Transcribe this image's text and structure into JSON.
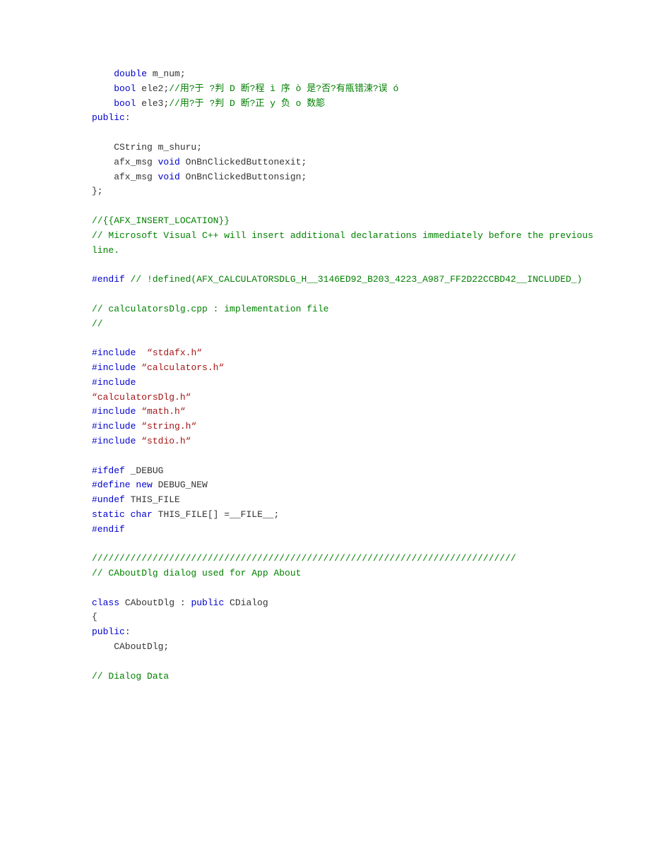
{
  "lines": [
    {
      "segments": [
        {
          "t": "    ",
          "c": ""
        },
        {
          "t": "double",
          "c": "kw"
        },
        {
          "t": " m_num;",
          "c": ""
        }
      ]
    },
    {
      "segments": [
        {
          "t": "    ",
          "c": ""
        },
        {
          "t": "bool",
          "c": "kw"
        },
        {
          "t": " ele2;",
          "c": ""
        },
        {
          "t": "//用?于 ?判 D 断?程 ì 序 ò 是?否?有甁错涑?误 ó",
          "c": "cm"
        }
      ]
    },
    {
      "segments": [
        {
          "t": "    ",
          "c": ""
        },
        {
          "t": "bool",
          "c": "kw"
        },
        {
          "t": " ele3;",
          "c": ""
        },
        {
          "t": "//用?于 ?判 D 断?正 y 负 o 数簓",
          "c": "cm"
        }
      ]
    },
    {
      "segments": [
        {
          "t": "public",
          "c": "kw"
        },
        {
          "t": ":",
          "c": ""
        }
      ]
    },
    {
      "segments": [
        {
          "t": " ",
          "c": ""
        }
      ]
    },
    {
      "segments": [
        {
          "t": "    CString m_shuru;",
          "c": ""
        }
      ]
    },
    {
      "segments": [
        {
          "t": "    afx_msg ",
          "c": ""
        },
        {
          "t": "void",
          "c": "kw"
        },
        {
          "t": " OnBnClickedButtonexit;",
          "c": ""
        }
      ]
    },
    {
      "segments": [
        {
          "t": "    afx_msg ",
          "c": ""
        },
        {
          "t": "void",
          "c": "kw"
        },
        {
          "t": " OnBnClickedButtonsign;",
          "c": ""
        }
      ]
    },
    {
      "segments": [
        {
          "t": "};",
          "c": ""
        }
      ]
    },
    {
      "segments": [
        {
          "t": " ",
          "c": ""
        }
      ]
    },
    {
      "segments": [
        {
          "t": "//{{AFX_INSERT_LOCATION}}",
          "c": "cm"
        }
      ]
    },
    {
      "segments": [
        {
          "t": "// Microsoft Visual C++ will insert additional declarations immediately before the previous line.",
          "c": "cm"
        }
      ],
      "wrap": true
    },
    {
      "segments": [
        {
          "t": " ",
          "c": ""
        }
      ]
    },
    {
      "segments": [
        {
          "t": "#endif ",
          "c": "kw"
        },
        {
          "t": "// !defined(AFX_CALCULATORSDLG_H__3146ED92_B203_4223_A987_FF2D22CCBD42__INCLUDED_)",
          "c": "cm"
        }
      ]
    },
    {
      "segments": [
        {
          "t": " ",
          "c": ""
        }
      ]
    },
    {
      "segments": [
        {
          "t": "// calculatorsDlg.cpp : implementation file",
          "c": "cm"
        }
      ]
    },
    {
      "segments": [
        {
          "t": "//",
          "c": "cm"
        }
      ]
    },
    {
      "segments": [
        {
          "t": " ",
          "c": ""
        }
      ]
    },
    {
      "segments": [
        {
          "t": "#include",
          "c": "kw"
        },
        {
          "t": "  ",
          "c": ""
        },
        {
          "t": "“stdafx.h“",
          "c": "str"
        }
      ]
    },
    {
      "segments": [
        {
          "t": "#include",
          "c": "kw"
        },
        {
          "t": " ",
          "c": ""
        },
        {
          "t": "“calculators.h“",
          "c": "str"
        }
      ]
    },
    {
      "segments": [
        {
          "t": "#include",
          "c": "kw"
        }
      ]
    },
    {
      "segments": [
        {
          "t": "“calculatorsDlg.h“",
          "c": "str"
        }
      ]
    },
    {
      "segments": [
        {
          "t": "#include",
          "c": "kw"
        },
        {
          "t": " ",
          "c": ""
        },
        {
          "t": "“math.h“",
          "c": "str"
        }
      ]
    },
    {
      "segments": [
        {
          "t": "#include",
          "c": "kw"
        },
        {
          "t": " ",
          "c": ""
        },
        {
          "t": "“string.h“",
          "c": "str"
        }
      ]
    },
    {
      "segments": [
        {
          "t": "#include",
          "c": "kw"
        },
        {
          "t": " ",
          "c": ""
        },
        {
          "t": "“stdio.h“",
          "c": "str"
        }
      ]
    },
    {
      "segments": [
        {
          "t": " ",
          "c": ""
        }
      ]
    },
    {
      "segments": [
        {
          "t": "#ifdef",
          "c": "kw"
        },
        {
          "t": " _DEBUG",
          "c": ""
        }
      ]
    },
    {
      "segments": [
        {
          "t": "#define",
          "c": "kw"
        },
        {
          "t": " ",
          "c": ""
        },
        {
          "t": "new",
          "c": "kw"
        },
        {
          "t": " DEBUG_NEW",
          "c": ""
        }
      ]
    },
    {
      "segments": [
        {
          "t": "#undef",
          "c": "kw"
        },
        {
          "t": " THIS_FILE",
          "c": ""
        }
      ]
    },
    {
      "segments": [
        {
          "t": "static",
          "c": "kw"
        },
        {
          "t": " ",
          "c": ""
        },
        {
          "t": "char",
          "c": "kw"
        },
        {
          "t": " THIS_FILE[] =__FILE__;",
          "c": ""
        }
      ]
    },
    {
      "segments": [
        {
          "t": "#endif",
          "c": "kw"
        }
      ]
    },
    {
      "segments": [
        {
          "t": " ",
          "c": ""
        }
      ]
    },
    {
      "segments": [
        {
          "t": "/////////////////////////////////////////////////////////////////////////////",
          "c": "cm"
        }
      ]
    },
    {
      "segments": [
        {
          "t": "// CAboutDlg dialog used for App About",
          "c": "cm"
        }
      ]
    },
    {
      "segments": [
        {
          "t": " ",
          "c": ""
        }
      ]
    },
    {
      "segments": [
        {
          "t": "class",
          "c": "kw"
        },
        {
          "t": " CAboutDlg : ",
          "c": ""
        },
        {
          "t": "public",
          "c": "kw"
        },
        {
          "t": " CDialog",
          "c": ""
        }
      ]
    },
    {
      "segments": [
        {
          "t": "{",
          "c": ""
        }
      ]
    },
    {
      "segments": [
        {
          "t": "public",
          "c": "kw"
        },
        {
          "t": ":",
          "c": ""
        }
      ]
    },
    {
      "segments": [
        {
          "t": "    CAboutDlg;",
          "c": ""
        }
      ]
    },
    {
      "segments": [
        {
          "t": " ",
          "c": ""
        }
      ]
    },
    {
      "segments": [
        {
          "t": "// Dialog Data",
          "c": "cm"
        }
      ]
    }
  ]
}
